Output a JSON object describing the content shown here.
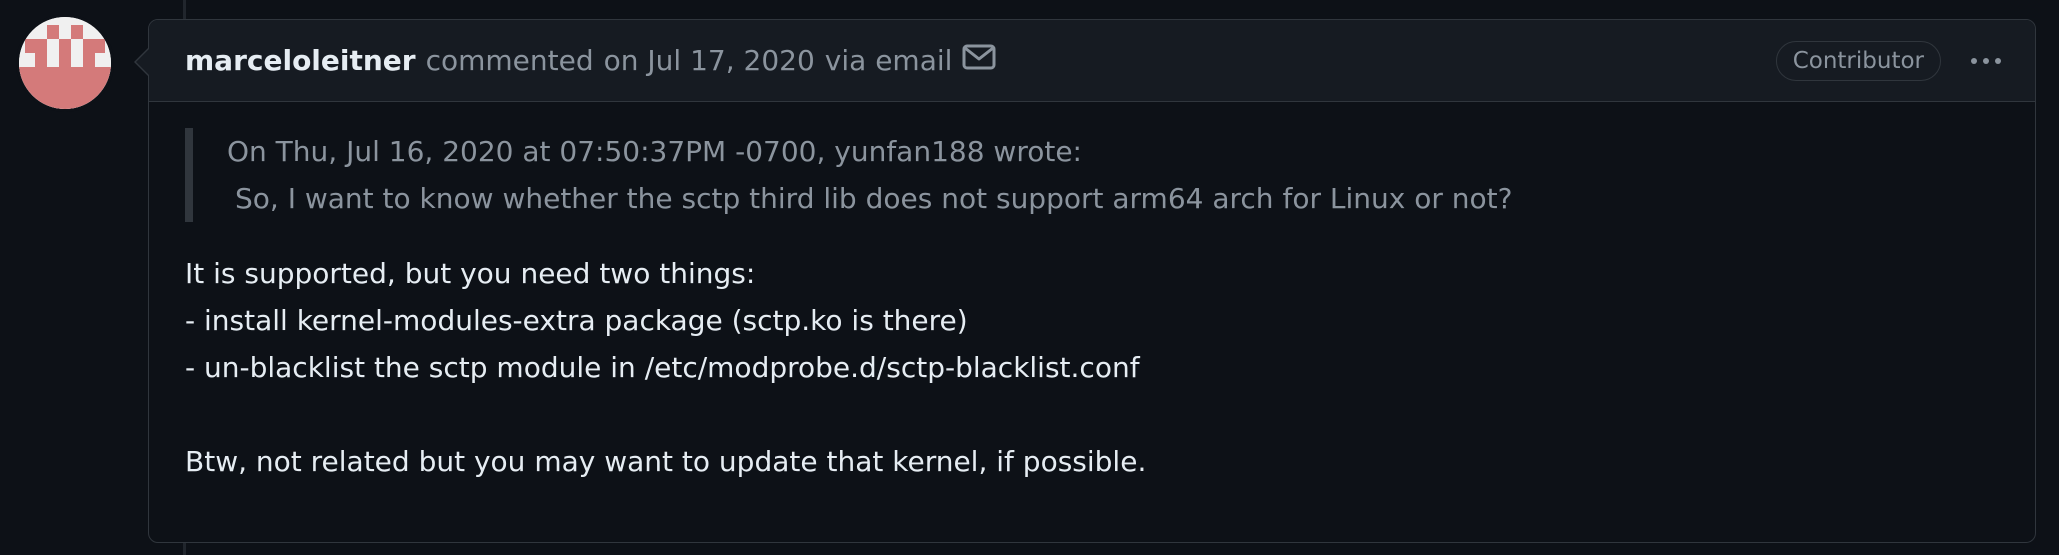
{
  "comment": {
    "author": "marceloleitner",
    "action": "commented",
    "date": "on Jul 17, 2020",
    "via": "via email",
    "mail_icon": "mail-icon",
    "badge": "Contributor",
    "menu_icon": "kebab-horizontal-icon",
    "quote": {
      "line1": "On Thu, Jul 16, 2020 at 07:50:37PM -0700, yunfan188 wrote:",
      "line2": "So, I want to know whether the sctp third lib does not support arm64 arch for Linux or not?"
    },
    "body": {
      "lines": [
        "It is supported, but you need two things:",
        "- install kernel-modules-extra package (sctp.ko is there)",
        "- un-blacklist the sctp module in /etc/modprobe.d/sctp-blacklist.conf"
      ],
      "closing": "Btw, not related but you may want to update that kernel, if possible."
    }
  },
  "colors": {
    "background": "#0d1117",
    "header_bg": "#161b22",
    "border": "#30363d",
    "text": "#e6edf3",
    "muted": "#8b949e",
    "avatar_pink": "#d47a7a"
  }
}
